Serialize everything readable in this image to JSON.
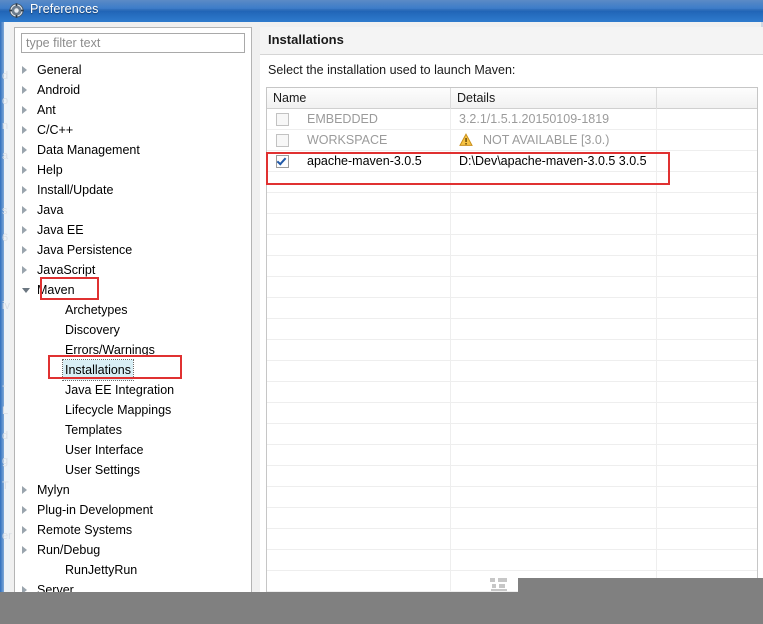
{
  "window": {
    "title": "Preferences",
    "icon": "gear-icon"
  },
  "sidebar": {
    "filter": {
      "value": "",
      "placeholder": "type filter text"
    },
    "items": [
      {
        "label": "General",
        "indent": 0,
        "state": "collapsed",
        "selected": false
      },
      {
        "label": "Android",
        "indent": 0,
        "state": "collapsed",
        "selected": false
      },
      {
        "label": "Ant",
        "indent": 0,
        "state": "collapsed",
        "selected": false
      },
      {
        "label": "C/C++",
        "indent": 0,
        "state": "collapsed",
        "selected": false
      },
      {
        "label": "Data Management",
        "indent": 0,
        "state": "collapsed",
        "selected": false
      },
      {
        "label": "Help",
        "indent": 0,
        "state": "collapsed",
        "selected": false
      },
      {
        "label": "Install/Update",
        "indent": 0,
        "state": "collapsed",
        "selected": false
      },
      {
        "label": "Java",
        "indent": 0,
        "state": "collapsed",
        "selected": false
      },
      {
        "label": "Java EE",
        "indent": 0,
        "state": "collapsed",
        "selected": false
      },
      {
        "label": "Java Persistence",
        "indent": 0,
        "state": "collapsed",
        "selected": false
      },
      {
        "label": "JavaScript",
        "indent": 0,
        "state": "collapsed",
        "selected": false
      },
      {
        "label": "Maven",
        "indent": 0,
        "state": "expanded",
        "selected": false
      },
      {
        "label": "Archetypes",
        "indent": 1,
        "state": "leaf",
        "selected": false
      },
      {
        "label": "Discovery",
        "indent": 1,
        "state": "leaf",
        "selected": false
      },
      {
        "label": "Errors/Warnings",
        "indent": 1,
        "state": "leaf",
        "selected": false
      },
      {
        "label": "Installations",
        "indent": 1,
        "state": "leaf",
        "selected": true
      },
      {
        "label": "Java EE Integration",
        "indent": 1,
        "state": "leaf",
        "selected": false
      },
      {
        "label": "Lifecycle Mappings",
        "indent": 1,
        "state": "leaf",
        "selected": false
      },
      {
        "label": "Templates",
        "indent": 1,
        "state": "leaf",
        "selected": false
      },
      {
        "label": "User Interface",
        "indent": 1,
        "state": "leaf",
        "selected": false
      },
      {
        "label": "User Settings",
        "indent": 1,
        "state": "leaf",
        "selected": false
      },
      {
        "label": "Mylyn",
        "indent": 0,
        "state": "collapsed",
        "selected": false
      },
      {
        "label": "Plug-in Development",
        "indent": 0,
        "state": "collapsed",
        "selected": false
      },
      {
        "label": "Remote Systems",
        "indent": 0,
        "state": "collapsed",
        "selected": false
      },
      {
        "label": "Run/Debug",
        "indent": 0,
        "state": "collapsed",
        "selected": false
      },
      {
        "label": "RunJettyRun",
        "indent": 1,
        "state": "leaf",
        "selected": false
      },
      {
        "label": "Server",
        "indent": 0,
        "state": "collapsed",
        "selected": false
      }
    ]
  },
  "content": {
    "title": "Installations",
    "caption": "Select the installation used to launch Maven:",
    "table": {
      "columns": [
        "Name",
        "Details",
        ""
      ],
      "rows": [
        {
          "checked": false,
          "enabled": false,
          "name": "EMBEDDED",
          "details": "3.2.1/1.5.1.20150109-1819",
          "warning": false,
          "extra": ""
        },
        {
          "checked": false,
          "enabled": false,
          "name": "WORKSPACE",
          "details": "NOT AVAILABLE [3.0.)",
          "warning": true,
          "extra": ""
        },
        {
          "checked": true,
          "enabled": true,
          "name": "apache-maven-3.0.5",
          "details": "D:\\Dev\\apache-maven-3.0.5 3.0.5",
          "warning": false,
          "extra": ""
        }
      ]
    }
  },
  "annotations": {
    "color": "#e03131",
    "boxes": [
      "maven-tree-item",
      "installations-tree-item",
      "active-installation-row"
    ]
  }
}
